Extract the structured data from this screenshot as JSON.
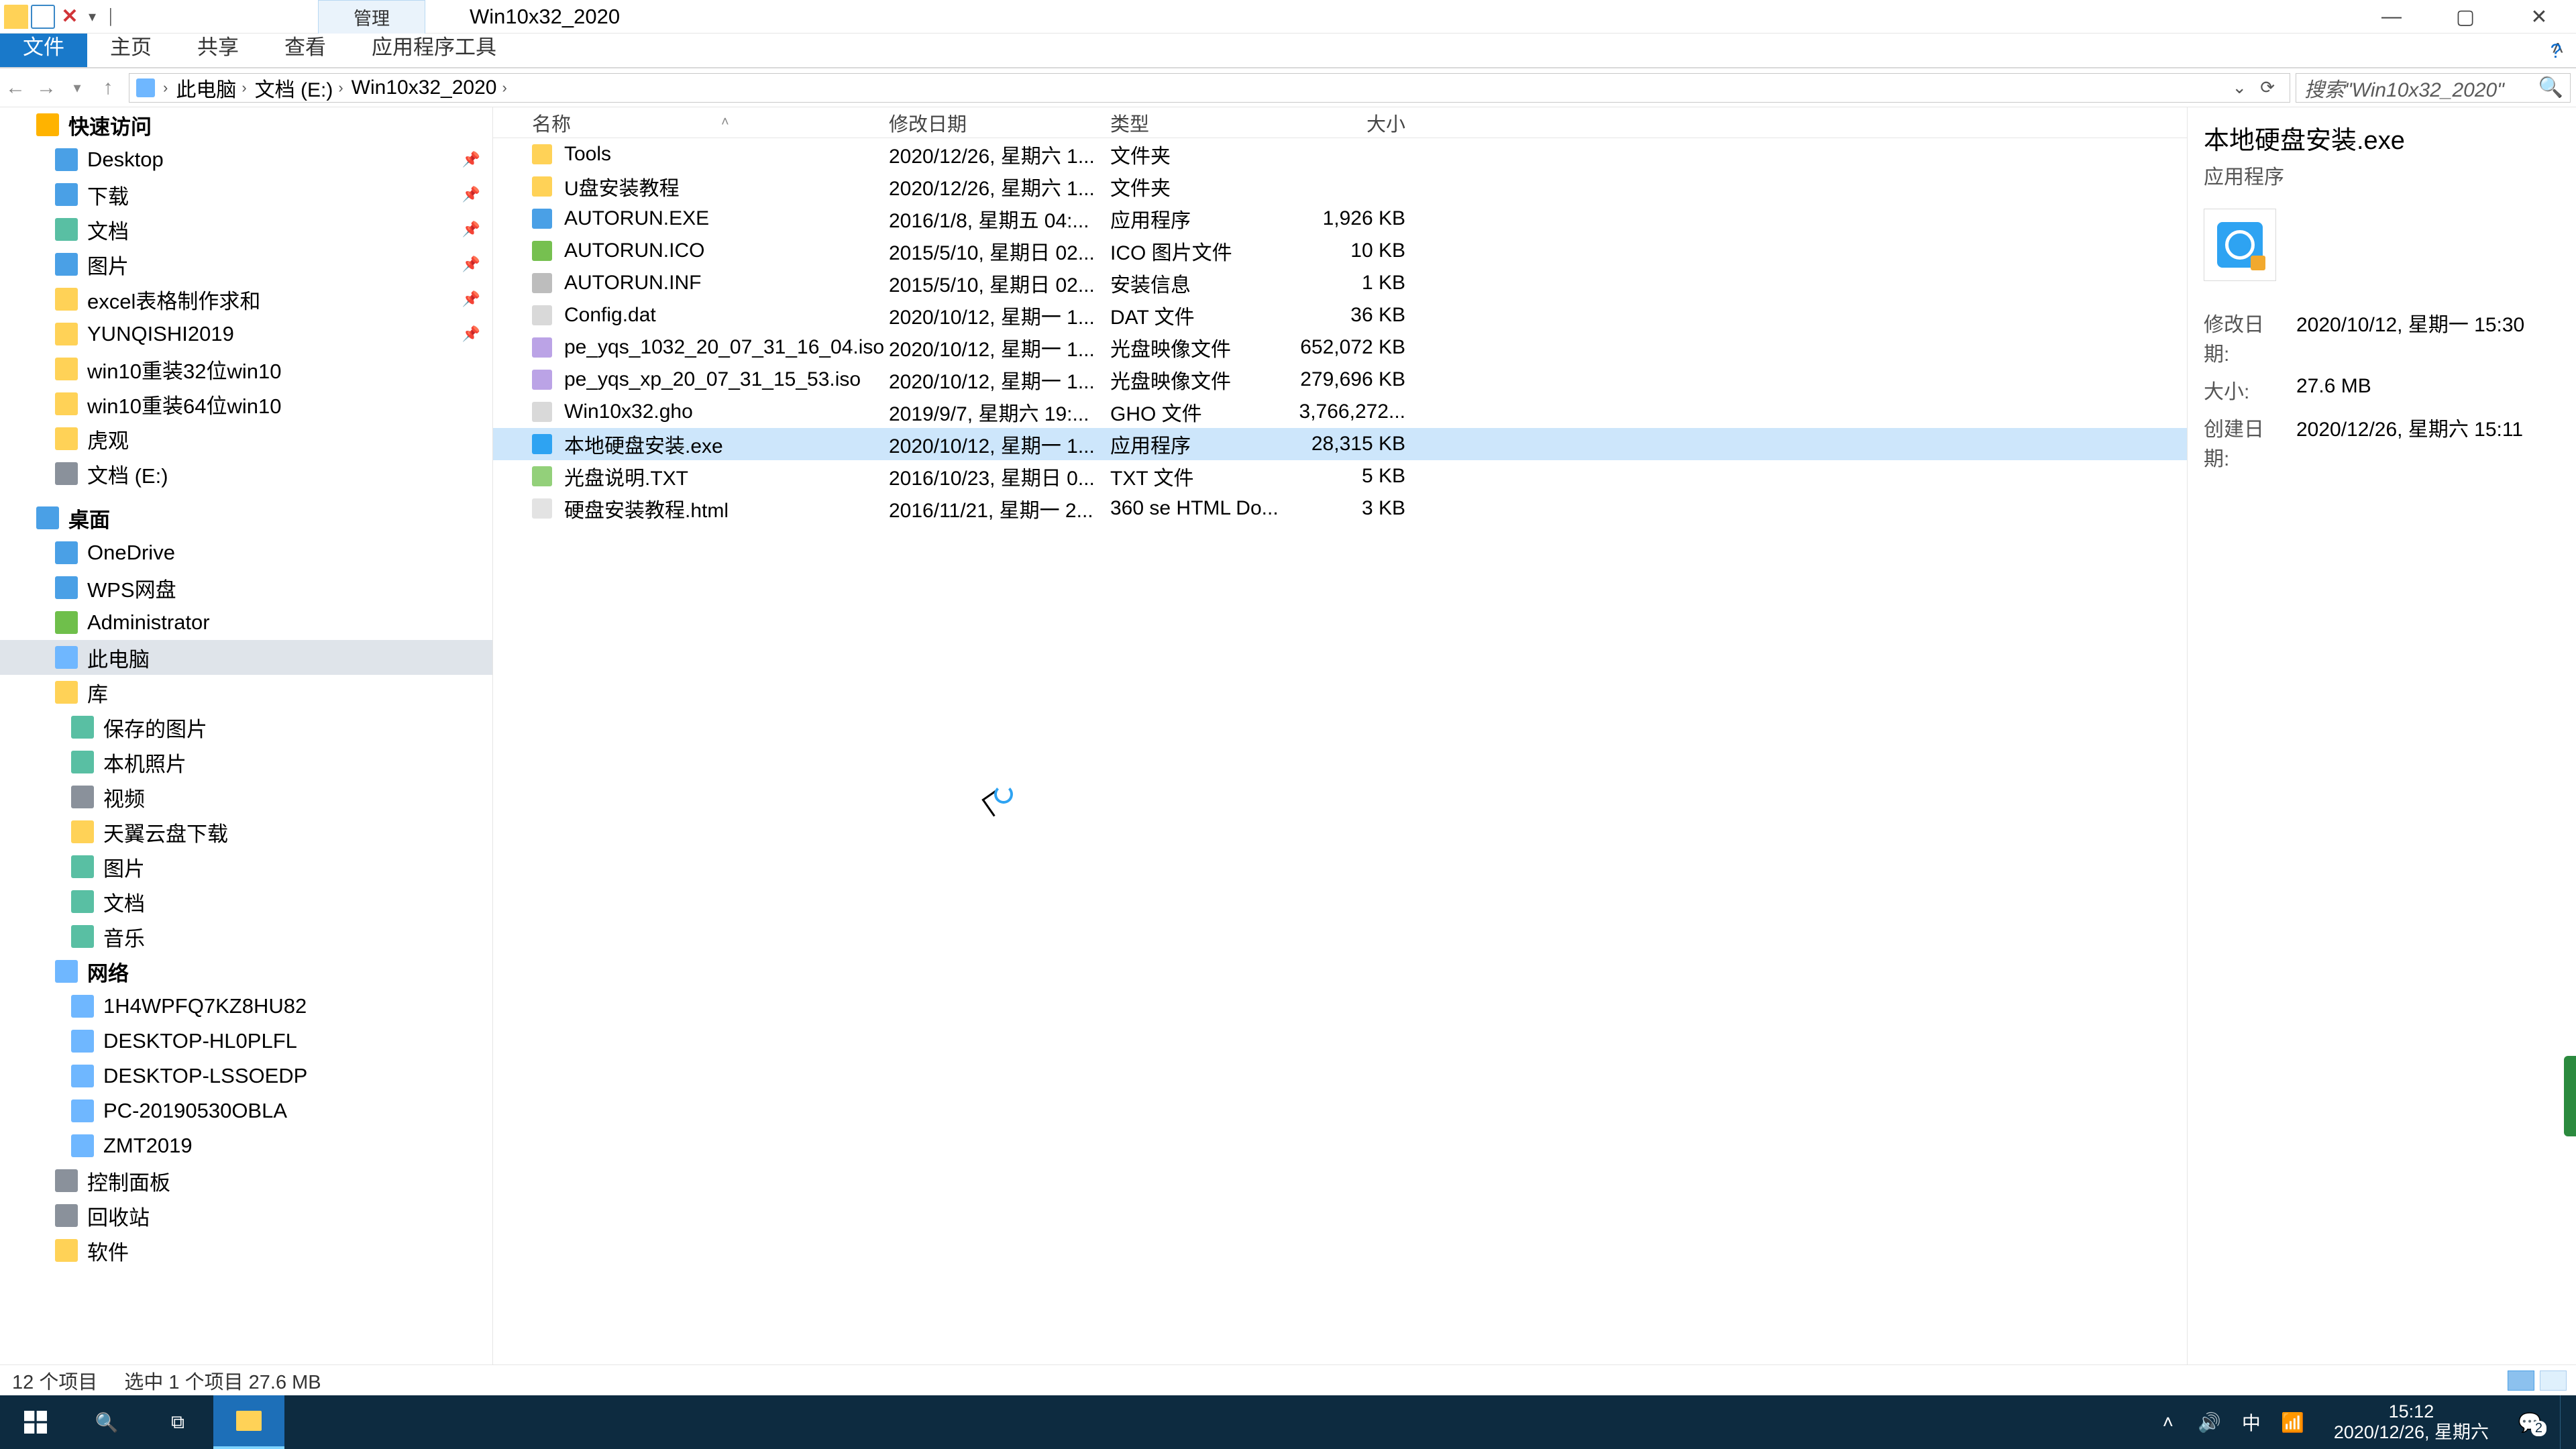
{
  "titlebar": {
    "manage_label": "管理",
    "window_title": "Win10x32_2020"
  },
  "ribbon": {
    "file": "文件",
    "home": "主页",
    "share": "共享",
    "view": "查看",
    "apptools": "应用程序工具"
  },
  "breadcrumb": [
    "此电脑",
    "文档 (E:)",
    "Win10x32_2020"
  ],
  "search_placeholder": "搜索\"Win10x32_2020\"",
  "nav": {
    "quick": "快速访问",
    "quick_items": [
      {
        "label": "Desktop",
        "pin": true,
        "ico": "ico-blue"
      },
      {
        "label": "下载",
        "pin": true,
        "ico": "ico-blue"
      },
      {
        "label": "文档",
        "pin": true,
        "ico": "ico-teal"
      },
      {
        "label": "图片",
        "pin": true,
        "ico": "ico-blue"
      },
      {
        "label": "excel表格制作求和",
        "pin": true,
        "ico": "ico-yellow"
      },
      {
        "label": "YUNQISHI2019",
        "pin": true,
        "ico": "ico-yellow"
      },
      {
        "label": "win10重装32位win10",
        "pin": false,
        "ico": "ico-yellow"
      },
      {
        "label": "win10重装64位win10",
        "pin": false,
        "ico": "ico-yellow"
      },
      {
        "label": "虎观",
        "pin": false,
        "ico": "ico-yellow"
      },
      {
        "label": "文档 (E:)",
        "pin": false,
        "ico": "ico-gray"
      }
    ],
    "desktop": "桌面",
    "desktop_items": [
      {
        "label": "OneDrive",
        "ico": "ico-blue"
      },
      {
        "label": "WPS网盘",
        "ico": "ico-blue"
      },
      {
        "label": "Administrator",
        "ico": "ico-green"
      },
      {
        "label": "此电脑",
        "ico": "ico-pc",
        "selected": true
      },
      {
        "label": "库",
        "ico": "ico-yellow"
      }
    ],
    "library_items": [
      {
        "label": "保存的图片",
        "ico": "ico-teal"
      },
      {
        "label": "本机照片",
        "ico": "ico-teal"
      },
      {
        "label": "视频",
        "ico": "ico-gray"
      },
      {
        "label": "天翼云盘下载",
        "ico": "ico-yellow"
      },
      {
        "label": "图片",
        "ico": "ico-teal"
      },
      {
        "label": "文档",
        "ico": "ico-teal"
      },
      {
        "label": "音乐",
        "ico": "ico-teal"
      }
    ],
    "network": "网络",
    "network_items": [
      {
        "label": "1H4WPFQ7KZ8HU82",
        "ico": "ico-pc"
      },
      {
        "label": "DESKTOP-HL0PLFL",
        "ico": "ico-pc"
      },
      {
        "label": "DESKTOP-LSSOEDP",
        "ico": "ico-pc"
      },
      {
        "label": "PC-20190530OBLA",
        "ico": "ico-pc"
      },
      {
        "label": "ZMT2019",
        "ico": "ico-pc"
      }
    ],
    "tail_items": [
      {
        "label": "控制面板",
        "ico": "ico-gray"
      },
      {
        "label": "回收站",
        "ico": "ico-gray"
      },
      {
        "label": "软件",
        "ico": "ico-yellow"
      }
    ]
  },
  "columns": {
    "name": "名称",
    "date": "修改日期",
    "type": "类型",
    "size": "大小"
  },
  "files": [
    {
      "ico": "fi-folder",
      "name": "Tools",
      "date": "2020/12/26, 星期六 1...",
      "type": "文件夹",
      "size": ""
    },
    {
      "ico": "fi-folder",
      "name": "U盘安装教程",
      "date": "2020/12/26, 星期六 1...",
      "type": "文件夹",
      "size": ""
    },
    {
      "ico": "fi-exe",
      "name": "AUTORUN.EXE",
      "date": "2016/1/8, 星期五 04:...",
      "type": "应用程序",
      "size": "1,926 KB"
    },
    {
      "ico": "fi-ico",
      "name": "AUTORUN.ICO",
      "date": "2015/5/10, 星期日 02...",
      "type": "ICO 图片文件",
      "size": "10 KB"
    },
    {
      "ico": "fi-inf",
      "name": "AUTORUN.INF",
      "date": "2015/5/10, 星期日 02...",
      "type": "安装信息",
      "size": "1 KB"
    },
    {
      "ico": "fi-dat",
      "name": "Config.dat",
      "date": "2020/10/12, 星期一 1...",
      "type": "DAT 文件",
      "size": "36 KB"
    },
    {
      "ico": "fi-iso",
      "name": "pe_yqs_1032_20_07_31_16_04.iso",
      "date": "2020/10/12, 星期一 1...",
      "type": "光盘映像文件",
      "size": "652,072 KB"
    },
    {
      "ico": "fi-iso",
      "name": "pe_yqs_xp_20_07_31_15_53.iso",
      "date": "2020/10/12, 星期一 1...",
      "type": "光盘映像文件",
      "size": "279,696 KB"
    },
    {
      "ico": "fi-gho",
      "name": "Win10x32.gho",
      "date": "2019/9/7, 星期六 19:...",
      "type": "GHO 文件",
      "size": "3,766,272..."
    },
    {
      "ico": "fi-app",
      "name": "本地硬盘安装.exe",
      "date": "2020/10/12, 星期一 1...",
      "type": "应用程序",
      "size": "28,315 KB",
      "selected": true
    },
    {
      "ico": "fi-txt",
      "name": "光盘说明.TXT",
      "date": "2016/10/23, 星期日 0...",
      "type": "TXT 文件",
      "size": "5 KB"
    },
    {
      "ico": "fi-html",
      "name": "硬盘安装教程.html",
      "date": "2016/11/21, 星期一 2...",
      "type": "360 se HTML Do...",
      "size": "3 KB"
    }
  ],
  "details": {
    "title": "本地硬盘安装.exe",
    "subtitle": "应用程序",
    "modified_k": "修改日期:",
    "modified_v": "2020/10/12, 星期一 15:30",
    "size_k": "大小:",
    "size_v": "27.6 MB",
    "created_k": "创建日期:",
    "created_v": "2020/12/26, 星期六 15:11"
  },
  "status": {
    "count": "12 个项目",
    "selected": "选中 1 个项目  27.6 MB"
  },
  "tray": {
    "ime": "中",
    "time": "15:12",
    "date": "2020/12/26, 星期六",
    "badge": "2"
  }
}
